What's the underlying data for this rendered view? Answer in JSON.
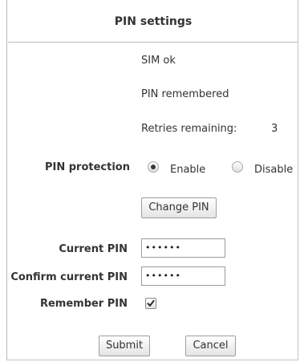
{
  "header": {
    "title": "PIN settings"
  },
  "status": {
    "sim": "SIM ok",
    "pin_state": "PIN remembered",
    "retries_label": "Retries remaining:",
    "retries_value": "3"
  },
  "pin_protection": {
    "label": "PIN protection",
    "options": [
      {
        "label": "Enable",
        "selected": true
      },
      {
        "label": "Disable",
        "selected": false
      }
    ],
    "change_button": "Change PIN"
  },
  "form": {
    "current_pin_label": "Current PIN",
    "current_pin_value": "••••••",
    "confirm_pin_label": "Confirm current PIN",
    "confirm_pin_value": "••••••",
    "remember_label": "Remember PIN",
    "remember_checked": true
  },
  "actions": {
    "submit": "Submit",
    "cancel": "Cancel"
  }
}
